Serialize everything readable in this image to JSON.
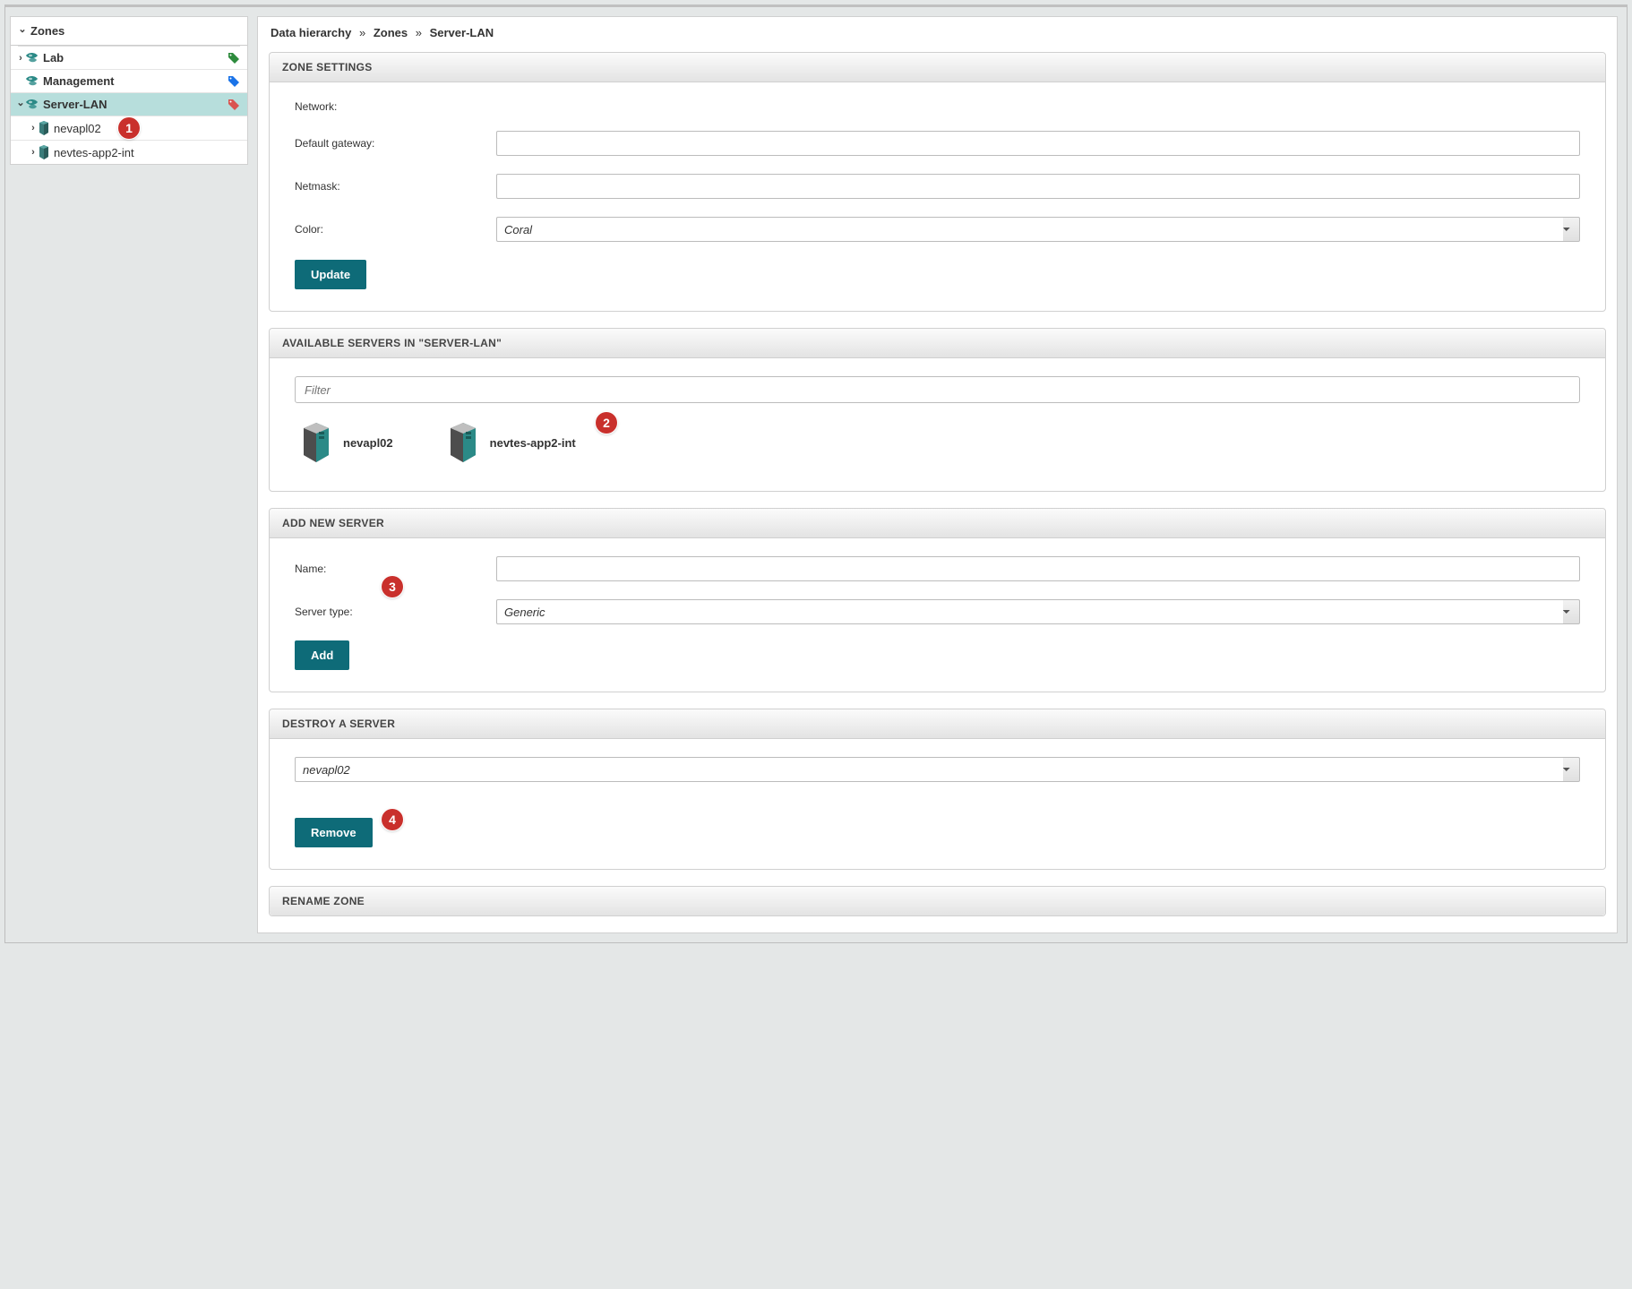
{
  "sidebar": {
    "title": "Zones",
    "items": [
      {
        "label": "Lab",
        "tag_color": "#2e8b3d",
        "expanded": false,
        "selected": false
      },
      {
        "label": "Management",
        "tag_color": "#1a73e8",
        "expanded": null,
        "selected": false
      },
      {
        "label": "Server-LAN",
        "tag_color": "#d9534f",
        "expanded": true,
        "selected": true,
        "children": [
          {
            "label": "nevapl02"
          },
          {
            "label": "nevtes-app2-int"
          }
        ]
      }
    ]
  },
  "breadcrumb": {
    "root": "Data hierarchy",
    "mid": "Zones",
    "leaf": "Server-LAN"
  },
  "panels": {
    "zone_settings": {
      "title": "ZONE SETTINGS",
      "fields": {
        "network_label": "Network:",
        "gateway_label": "Default gateway:",
        "gateway_value": "",
        "netmask_label": "Netmask:",
        "netmask_value": "",
        "color_label": "Color:",
        "color_value": "Coral"
      },
      "submit": "Update"
    },
    "available": {
      "title": "AVAILABLE SERVERS IN \"SERVER-LAN\"",
      "filter_placeholder": "Filter",
      "servers": [
        {
          "name": "nevapl02"
        },
        {
          "name": "nevtes-app2-int"
        }
      ]
    },
    "add_server": {
      "title": "ADD NEW SERVER",
      "name_label": "Name:",
      "name_value": "",
      "type_label": "Server type:",
      "type_value": "Generic",
      "submit": "Add"
    },
    "destroy": {
      "title": "DESTROY A SERVER",
      "selected": "nevapl02",
      "submit": "Remove"
    },
    "rename": {
      "title": "RENAME ZONE"
    }
  },
  "badges": {
    "b1": "1",
    "b2": "2",
    "b3": "3",
    "b4": "4"
  }
}
